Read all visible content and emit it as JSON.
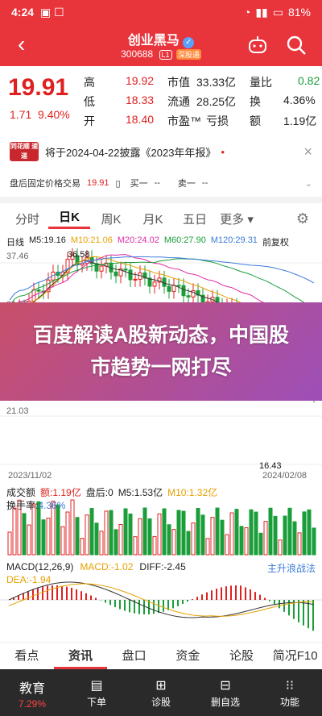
{
  "status": {
    "time": "4:24",
    "battery": "81%"
  },
  "header": {
    "title": "创业黑马",
    "code": "300688",
    "badge1": "L1",
    "badge2": "深股通"
  },
  "quote": {
    "price": "19.91",
    "change": "1.71",
    "pct": "9.40%",
    "rows": [
      [
        "高",
        "19.92",
        "市值",
        "33.33亿",
        "量比",
        "0.82"
      ],
      [
        "低",
        "18.33",
        "流通",
        "28.25亿",
        "换",
        "4.36%"
      ],
      [
        "开",
        "18.40",
        "市盈™",
        "亏损",
        "额",
        "1.19亿"
      ]
    ]
  },
  "notice": {
    "logo": "同花顺 速递",
    "text": "将于2024-04-22披露《2023年年报》"
  },
  "fixed": {
    "label": "盘后固定价格交易",
    "price": "19.91",
    "buy": "买一",
    "sell": "卖一",
    "dash": "--"
  },
  "tabs": [
    "分时",
    "日K",
    "周K",
    "月K",
    "五日",
    "更多"
  ],
  "ma": {
    "lbl": "日线",
    "m5": "M5:19.16",
    "m10": "M10:21.06",
    "m20": "M20:24.02",
    "m60": "M60:27.90",
    "m120": "M120:29.31",
    "fq": "前复权"
  },
  "chart": {
    "y_top": "37.46",
    "y_mid1": "31.98",
    "y_mid2": "21.03",
    "y_bottom": "16.43",
    "high": "36.58",
    "date_left": "2023/11/02",
    "date_right": "2024/02/08",
    "colors": {
      "up": "#e02020",
      "down": "#1a9e3a",
      "m5": "#333333",
      "m10": "#e8a000",
      "m20": "#e02aa6",
      "m60": "#1a9e3a",
      "m120": "#3b7bd8"
    }
  },
  "overlay": {
    "text": "百度解读A股新动态，中国股市趋势一网打尽"
  },
  "volume": {
    "label": "成交额",
    "amount": "额:1.19亿",
    "close": "盘后:0",
    "m5": "M5:1.53亿",
    "m10": "M10:1.32亿",
    "turnover_label": "换手率:",
    "turnover": "4.36%"
  },
  "macd": {
    "label": "MACD(12,26,9)",
    "macd": "MACD:-1.02",
    "diff": "DIFF:-2.45",
    "link": "主升浪战法",
    "dea": "DEA:-1.94"
  },
  "bottom_tabs": [
    "看点",
    "资讯",
    "盘口",
    "资金",
    "论股",
    "简况F10"
  ],
  "bottom_bar": [
    {
      "label": "教育",
      "sub": "7.29%"
    },
    {
      "label": "下单",
      "sub": ""
    },
    {
      "label": "诊股",
      "sub": ""
    },
    {
      "label": "删自选",
      "sub": ""
    },
    {
      "label": "功能",
      "sub": ""
    }
  ]
}
